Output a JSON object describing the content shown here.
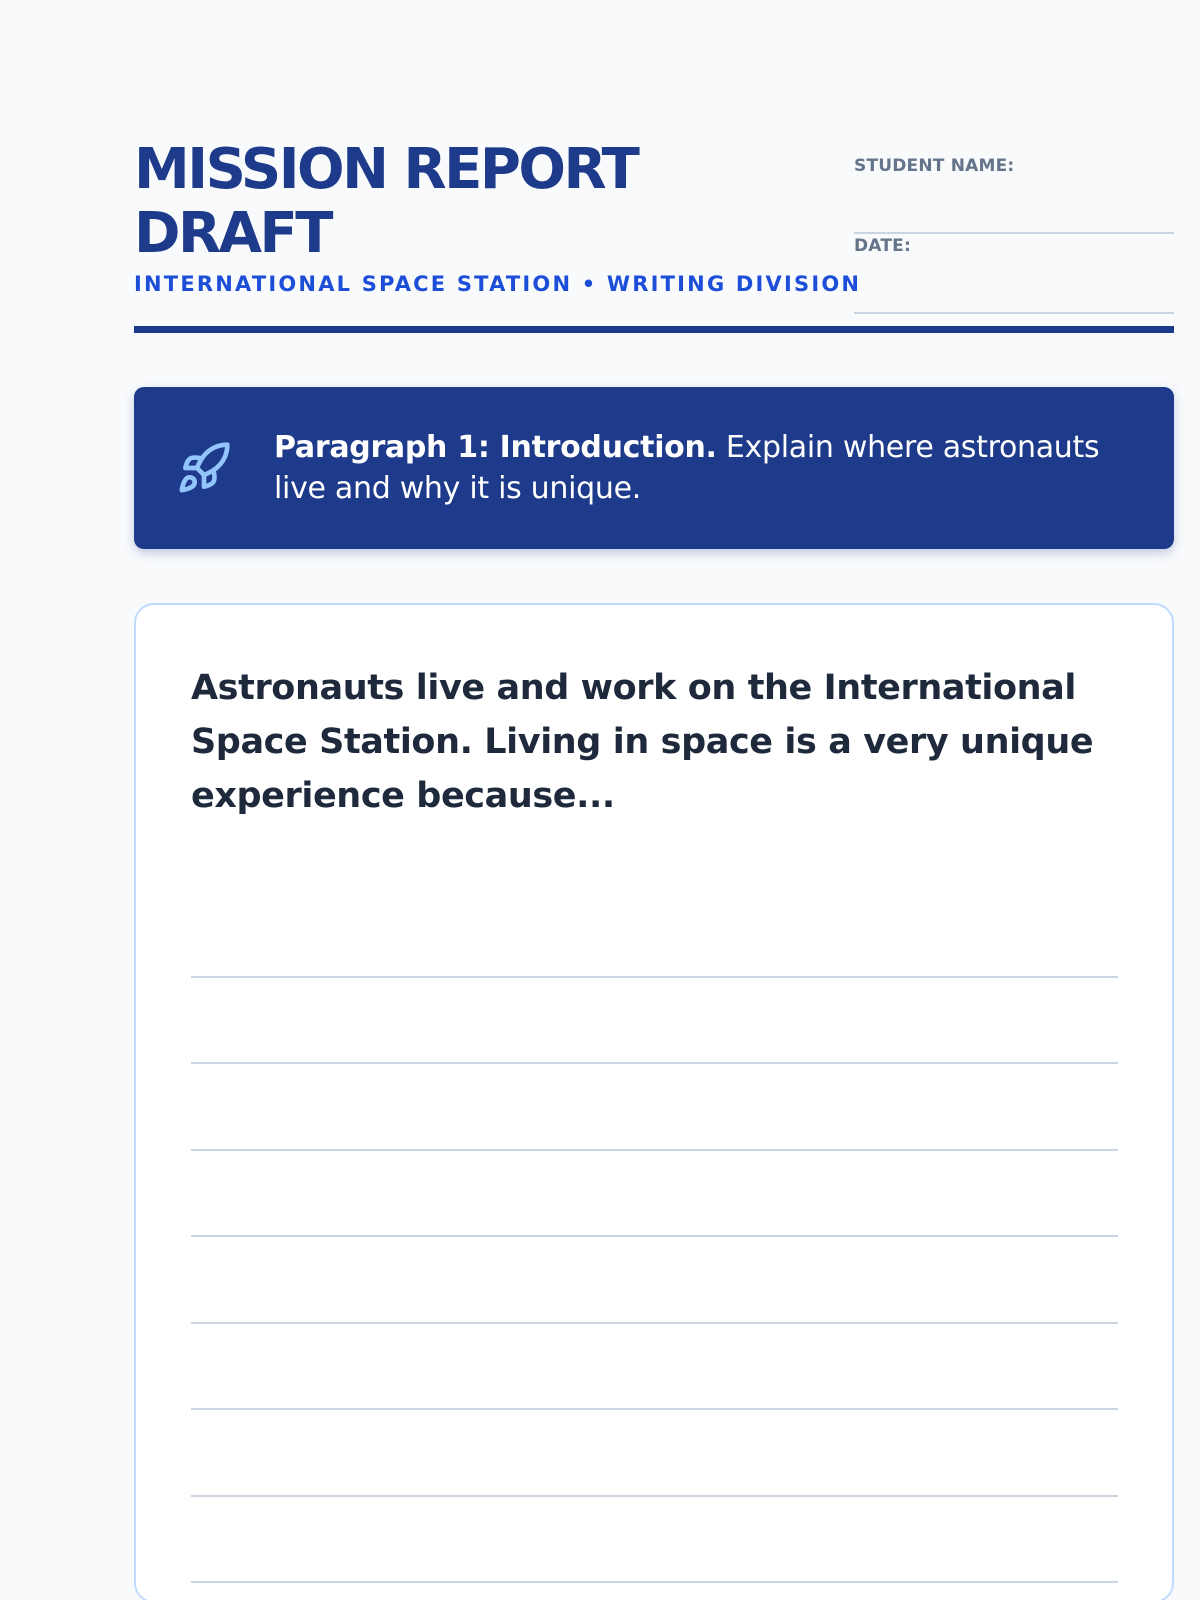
{
  "header": {
    "title_line1": "MISSION REPORT",
    "title_line2": "DRAFT",
    "subtitle": "INTERNATIONAL SPACE STATION • WRITING DIVISION"
  },
  "fields": {
    "student_name_label": "STUDENT NAME:",
    "student_name_value": "",
    "date_label": "DATE:",
    "date_value": ""
  },
  "prompt": {
    "icon": "rocket-icon",
    "heading": "Paragraph 1: Introduction.",
    "text": " Explain where astronauts live and why it is unique."
  },
  "writing": {
    "starter": "Astronauts live and work on the International Space Station. Living in space is a very unique experience because...",
    "lines": [
      "",
      "",
      "",
      "",
      "",
      "",
      "",
      ""
    ]
  },
  "colors": {
    "navy": "#1e3a8a",
    "blue": "#1d4ed8",
    "rocket": "#93c5fd",
    "card_border": "#bfdbfe",
    "line": "#cbd5e1"
  }
}
